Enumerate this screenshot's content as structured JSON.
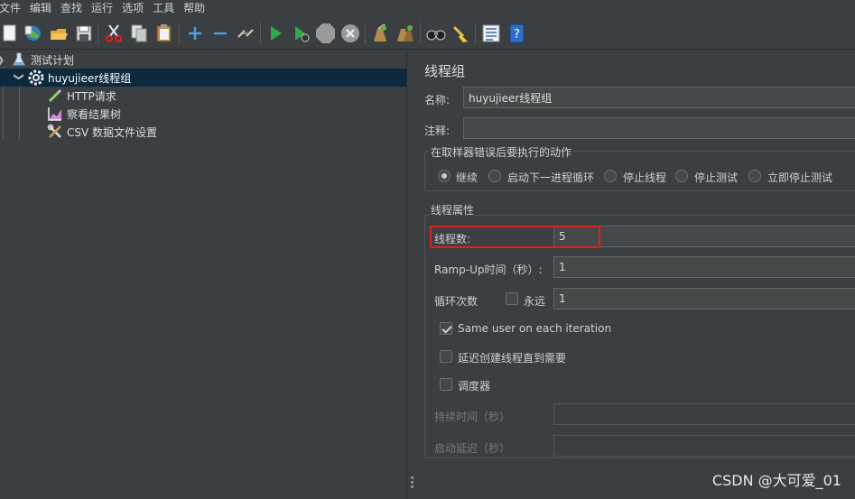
{
  "menu": [
    "文件",
    "编辑",
    "查找",
    "运行",
    "选项",
    "工具",
    "帮助"
  ],
  "toolbar": {
    "icons": [
      "new-icon",
      "templates-icon",
      "open-icon",
      "save-icon",
      "cut-icon",
      "copy-icon",
      "paste-icon",
      "expand-icon",
      "collapse-icon",
      "toggle-icon",
      "start-icon",
      "start-no-pauses-icon",
      "stop-icon",
      "shutdown-icon",
      "clear-icon",
      "clear-all-icon",
      "search-icon",
      "reset-search-icon",
      "function-helper-icon",
      "help-icon"
    ]
  },
  "tree": {
    "test_plan": "测试计划",
    "thread_group": "huyujieer线程组",
    "http_request": "HTTP请求",
    "results_tree": "察看结果树",
    "csv_config": "CSV 数据文件设置"
  },
  "panel": {
    "title": "线程组",
    "name_label": "名称:",
    "name_value": "huyujieer线程组",
    "comment_label": "注释:",
    "comment_value": "",
    "error_group_title": "在取样器错误后要执行的动作",
    "error_actions": [
      "继续",
      "启动下一进程循环",
      "停止线程",
      "停止测试",
      "立即停止测试"
    ],
    "error_selected": "继续",
    "props_title": "线程属性",
    "threads_label": "线程数:",
    "threads_value": "5",
    "rampup_label": "Ramp-Up时间（秒）:",
    "rampup_value": "1",
    "loop_label": "循环次数",
    "forever_label": "永远",
    "forever_checked": false,
    "loop_value": "1",
    "same_user_label": "Same user on each iteration",
    "same_user_checked": true,
    "delay_label": "延迟创建线程直到需要",
    "delay_checked": false,
    "scheduler_label": "调度器",
    "scheduler_checked": false,
    "duration_label": "持续时间（秒）",
    "duration_value": "",
    "startup_delay_label": "启动延迟（秒）",
    "startup_delay_value": ""
  },
  "watermark": "CSDN @大可爱_01",
  "colors": {
    "background": "#3c3f41",
    "selection": "#0d293e",
    "highlight_border": "#e0201c",
    "run_green": "#4aa84a"
  }
}
